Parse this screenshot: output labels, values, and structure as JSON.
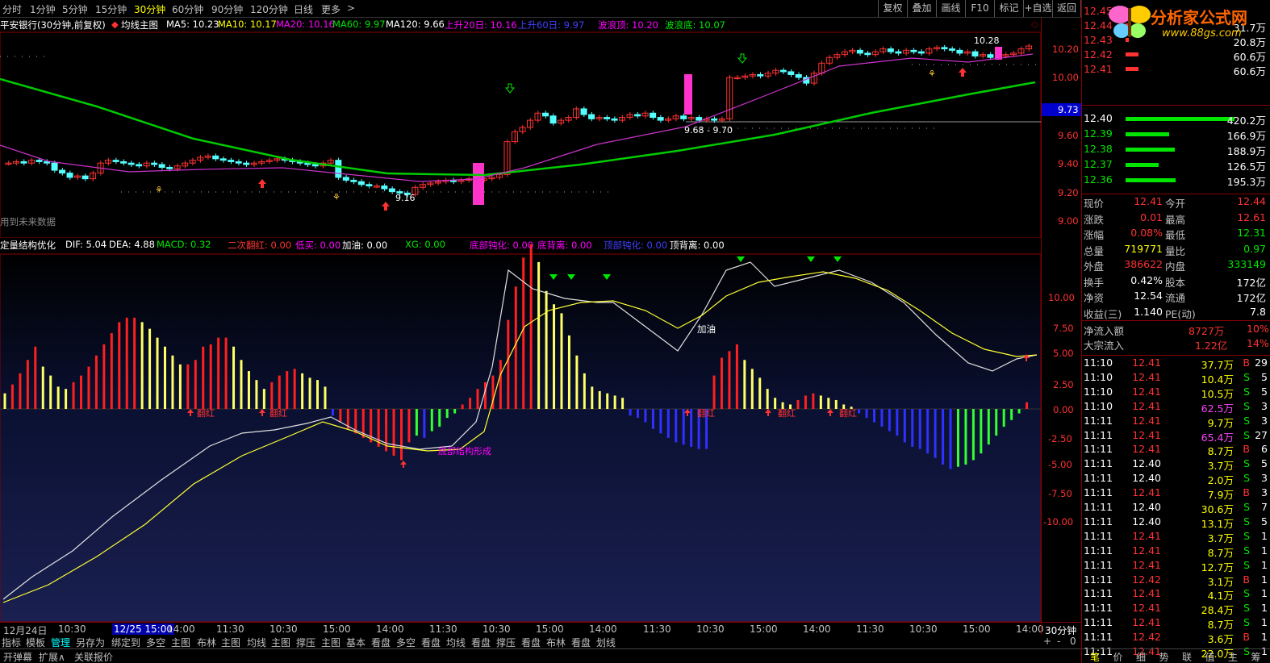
{
  "topbar": {
    "periods": [
      "分时",
      "1分钟",
      "5分钟",
      "15分钟",
      "30分钟",
      "60分钟",
      "90分钟",
      "120分钟",
      "日线",
      "更多"
    ],
    "active_period": "30分钟",
    "more_arrow": ">",
    "tools": [
      "复权",
      "叠加",
      "画线",
      "F10",
      "标记",
      "+自选",
      "返回"
    ]
  },
  "main": {
    "title": "平安银行(30分钟,前复权)",
    "template": "均线主图",
    "ma5": "MA5: 10.23",
    "ma10": "MA10: 10.17",
    "ma20": "MA20: 10.16",
    "ma60": "MA60: 9.97",
    "ma120": "MA120: 9.66",
    "up20": "上升20日: 10.16",
    "up60": "上升60日: 9.97",
    "wave_top": "波浪顶: 10.20",
    "wave_bottom": "波浪底: 10.07",
    "price_axis": [
      "10.20",
      "10.00",
      "9.80",
      "9.60",
      "9.40",
      "9.20",
      "9.00"
    ],
    "current_price_tag": "9.73",
    "label_high": "10.28",
    "label_low": "9.16",
    "label_range": "9.68 - 9.70",
    "future_note": "用到未来数据"
  },
  "sub": {
    "name": "定量结构优化",
    "dif": "DIF: 5.04",
    "dea": "DEA: 4.88",
    "macd": "MACD: 0.32",
    "s1": "二次翻红: 0.00",
    "s2": "低买: 0.00",
    "s3": "加油: 0.00",
    "s4": "XG: 0.00",
    "s5": "底部钝化: 0.00",
    "s6": "底背离: 0.00",
    "s7": "顶部钝化: 0.00",
    "s8": "顶背离: 0.00",
    "axis": [
      "10.00",
      "7.50",
      "5.00",
      "2.50",
      "0.00",
      "-2.50",
      "-5.00",
      "-7.50",
      "-10.00"
    ],
    "label_addoil": "加油",
    "label_flip": "翻红",
    "label_structure": "底部结构形成"
  },
  "time_axis": {
    "labels": [
      "12月24日",
      "10:30",
      "12/25 15:00",
      "14:00",
      "11:30",
      "10:30",
      "15:00",
      "14:00",
      "11:30",
      "10:30",
      "15:00",
      "14:00",
      "11:30",
      "10:30",
      "15:00",
      "14:00",
      "11:30",
      "10:30",
      "15:00",
      "14:00"
    ],
    "period": "30分钟"
  },
  "toolbar": {
    "items": [
      "指标",
      "模板",
      "管理",
      "另存为",
      "绑定到",
      "多空",
      "主图",
      "布林",
      "主图",
      "均线",
      "主图",
      "撑压",
      "主图",
      "基本",
      "看盘",
      "多空",
      "看盘",
      "均线",
      "看盘",
      "撑压",
      "看盘",
      "布林",
      "看盘",
      "划线"
    ],
    "zoom": [
      "+",
      "-",
      "0"
    ]
  },
  "bottombar": {
    "items": [
      "开弹幕",
      "扩展∧",
      "关联报价"
    ]
  },
  "logo": {
    "text": "分析家公式网",
    "url": "www.88gs.com"
  },
  "orderbook": {
    "asks": [
      {
        "price": "12.45",
        "vol": "",
        "bar": 0
      },
      {
        "price": "12.44",
        "vol": "31.7万",
        "bar": 0.05
      },
      {
        "price": "12.43",
        "vol": "20.8万",
        "bar": 0.03
      },
      {
        "price": "12.42",
        "vol": "60.6万",
        "bar": 0.12
      },
      {
        "price": "12.41",
        "vol": "60.6万",
        "bar": 0.12
      }
    ],
    "bids": [
      {
        "price": "12.40",
        "vol": "420.2万",
        "bar": 1.0
      },
      {
        "price": "12.39",
        "vol": "166.9万",
        "bar": 0.4
      },
      {
        "price": "12.38",
        "vol": "188.9万",
        "bar": 0.45
      },
      {
        "price": "12.37",
        "vol": "126.5万",
        "bar": 0.3
      },
      {
        "price": "12.36",
        "vol": "195.3万",
        "bar": 0.46
      }
    ]
  },
  "quote": [
    {
      "l1": "现价",
      "v1": "12.41",
      "c1": "red",
      "l2": "今开",
      "v2": "12.44",
      "c2": "red"
    },
    {
      "l1": "涨跌",
      "v1": "0.01",
      "c1": "red",
      "l2": "最高",
      "v2": "12.61",
      "c2": "red"
    },
    {
      "l1": "涨幅",
      "v1": "0.08%",
      "c1": "red",
      "l2": "最低",
      "v2": "12.31",
      "c2": "green"
    },
    {
      "l1": "总量",
      "v1": "719771",
      "c1": "yellow",
      "l2": "量比",
      "v2": "0.97",
      "c2": "green"
    },
    {
      "l1": "外盘",
      "v1": "386622",
      "c1": "red",
      "l2": "内盘",
      "v2": "333149",
      "c2": "green"
    },
    {
      "l1": "换手",
      "v1": "0.42%",
      "c1": "white",
      "l2": "股本",
      "v2": "172亿",
      "c2": "white"
    },
    {
      "l1": "净资",
      "v1": "12.54",
      "c1": "white",
      "l2": "流通",
      "v2": "172亿",
      "c2": "white"
    },
    {
      "l1": "收益(三)",
      "v1": "1.140",
      "c1": "white",
      "l2": "PE(动)",
      "v2": "7.8",
      "c2": "white"
    }
  ],
  "flow": [
    {
      "label": "净流入额",
      "value": "8727万",
      "pct": "10%"
    },
    {
      "label": "大宗流入",
      "value": "1.22亿",
      "pct": "14%"
    }
  ],
  "ticks": [
    {
      "t": "11:10",
      "p": "12.41",
      "pc": "red",
      "v": "37.7万",
      "vc": "yellow",
      "d": "B",
      "n": "29"
    },
    {
      "t": "11:10",
      "p": "12.41",
      "pc": "red",
      "v": "10.4万",
      "vc": "yellow",
      "d": "S",
      "n": "5"
    },
    {
      "t": "11:10",
      "p": "12.41",
      "pc": "red",
      "v": "10.5万",
      "vc": "yellow",
      "d": "S",
      "n": "5"
    },
    {
      "t": "11:10",
      "p": "12.41",
      "pc": "red",
      "v": "62.5万",
      "vc": "mag",
      "d": "S",
      "n": "3"
    },
    {
      "t": "11:11",
      "p": "12.41",
      "pc": "red",
      "v": "9.7万",
      "vc": "yellow",
      "d": "S",
      "n": "3"
    },
    {
      "t": "11:11",
      "p": "12.41",
      "pc": "red",
      "v": "65.4万",
      "vc": "mag",
      "d": "S",
      "n": "27"
    },
    {
      "t": "11:11",
      "p": "12.41",
      "pc": "red",
      "v": "8.7万",
      "vc": "yellow",
      "d": "B",
      "n": "6"
    },
    {
      "t": "11:11",
      "p": "12.40",
      "pc": "white",
      "v": "3.7万",
      "vc": "yellow",
      "d": "S",
      "n": "5"
    },
    {
      "t": "11:11",
      "p": "12.40",
      "pc": "white",
      "v": "2.0万",
      "vc": "yellow",
      "d": "S",
      "n": "3"
    },
    {
      "t": "11:11",
      "p": "12.41",
      "pc": "red",
      "v": "7.9万",
      "vc": "yellow",
      "d": "B",
      "n": "3"
    },
    {
      "t": "11:11",
      "p": "12.40",
      "pc": "white",
      "v": "30.6万",
      "vc": "yellow",
      "d": "S",
      "n": "7"
    },
    {
      "t": "11:11",
      "p": "12.40",
      "pc": "white",
      "v": "13.1万",
      "vc": "yellow",
      "d": "S",
      "n": "5"
    },
    {
      "t": "11:11",
      "p": "12.41",
      "pc": "red",
      "v": "3.7万",
      "vc": "yellow",
      "d": "S",
      "n": "1"
    },
    {
      "t": "11:11",
      "p": "12.41",
      "pc": "red",
      "v": "8.7万",
      "vc": "yellow",
      "d": "S",
      "n": "1"
    },
    {
      "t": "11:11",
      "p": "12.41",
      "pc": "red",
      "v": "12.7万",
      "vc": "yellow",
      "d": "S",
      "n": "1"
    },
    {
      "t": "11:11",
      "p": "12.42",
      "pc": "red",
      "v": "3.1万",
      "vc": "yellow",
      "d": "B",
      "n": "1"
    },
    {
      "t": "11:11",
      "p": "12.41",
      "pc": "red",
      "v": "4.1万",
      "vc": "yellow",
      "d": "S",
      "n": "1"
    },
    {
      "t": "11:11",
      "p": "12.41",
      "pc": "red",
      "v": "28.4万",
      "vc": "yellow",
      "d": "S",
      "n": "1"
    },
    {
      "t": "11:11",
      "p": "12.41",
      "pc": "red",
      "v": "8.7万",
      "vc": "yellow",
      "d": "S",
      "n": "1"
    },
    {
      "t": "11:11",
      "p": "12.42",
      "pc": "red",
      "v": "3.6万",
      "vc": "yellow",
      "d": "B",
      "n": "1"
    },
    {
      "t": "11:11",
      "p": "12.41",
      "pc": "red",
      "v": "22.0万",
      "vc": "yellow",
      "d": "S",
      "n": "1"
    }
  ],
  "panel_tabs": [
    "笔",
    "价",
    "细",
    "势",
    "联",
    "值",
    "主",
    "筹"
  ],
  "colors": {
    "up": "#ff3232",
    "down": "#54ffff",
    "ma120": "#00cc00",
    "ma20": "#cc33cc",
    "axis": "#800000"
  }
}
